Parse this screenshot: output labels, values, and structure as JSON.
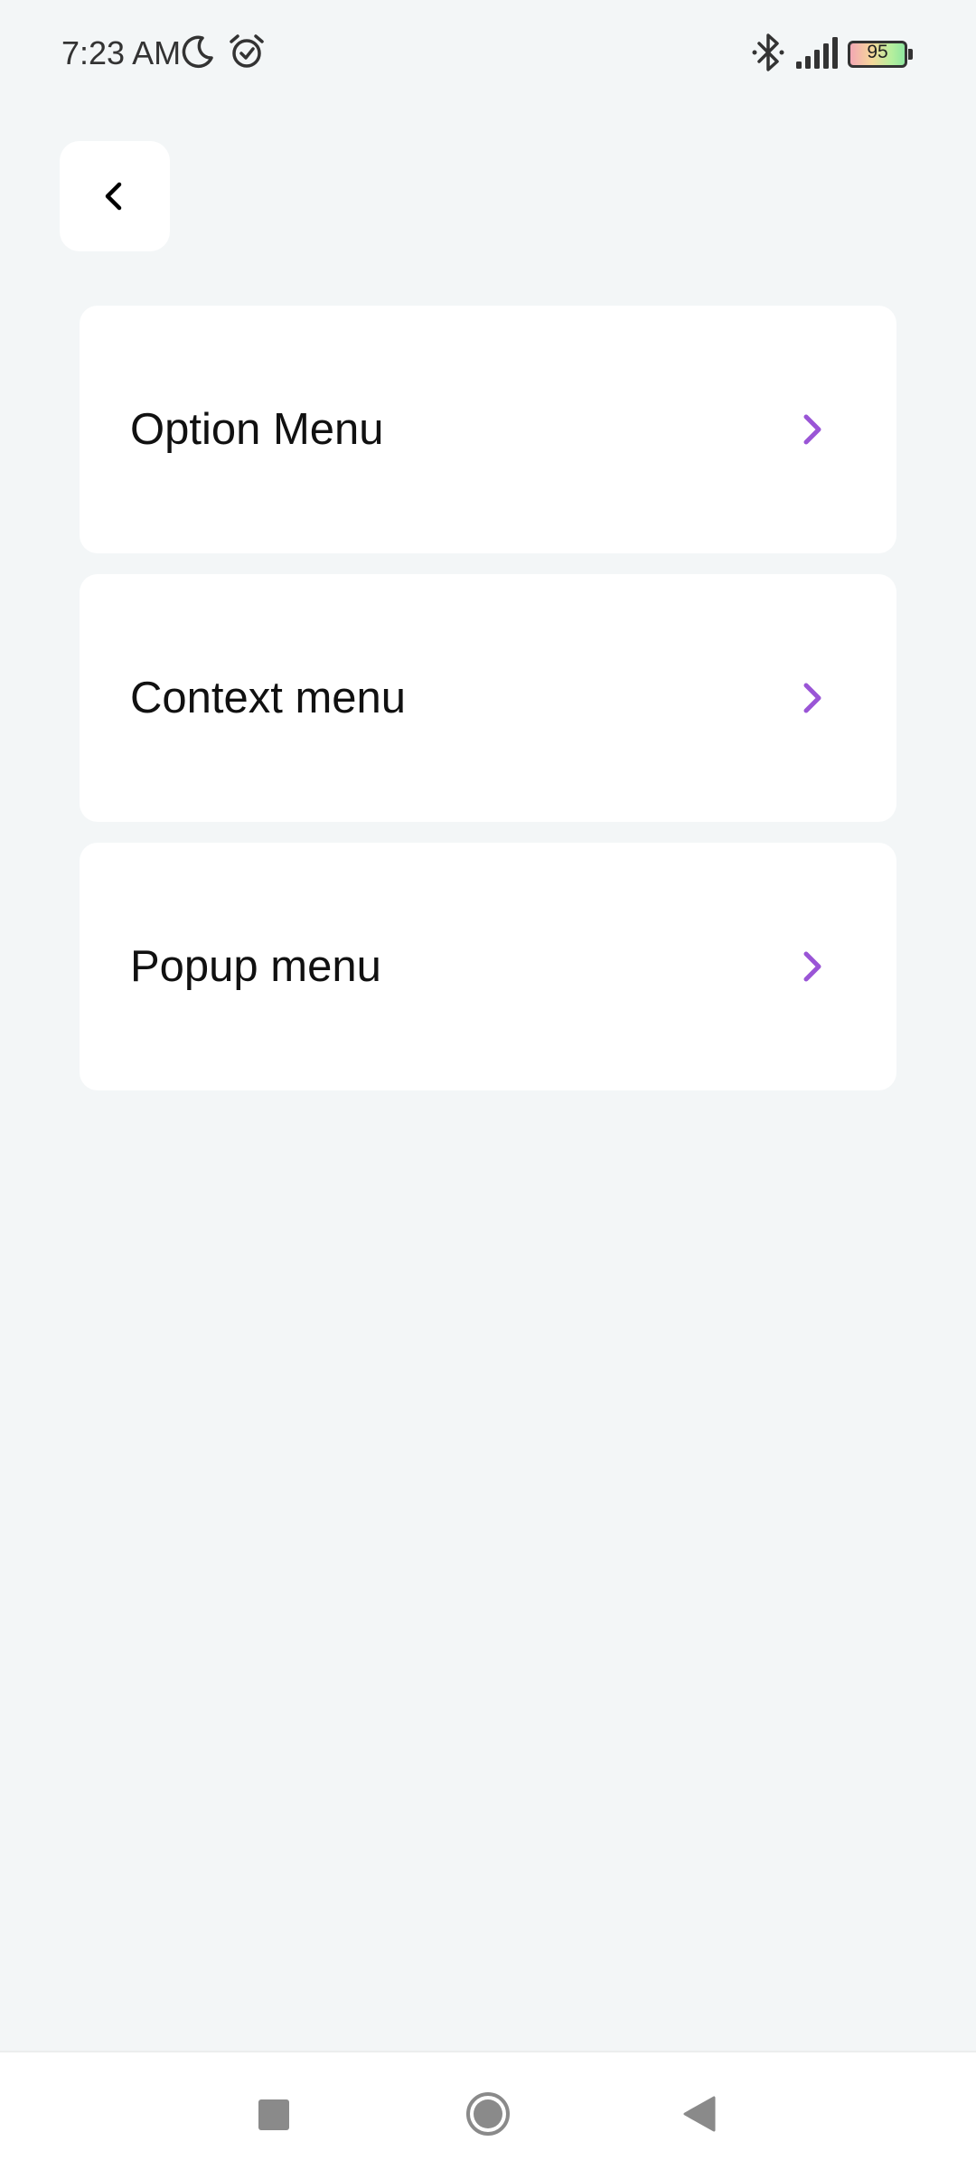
{
  "status_bar": {
    "time": "7:23 AM",
    "battery_level": "95",
    "icons": [
      "moon-icon",
      "alarm-icon",
      "bluetooth-icon",
      "signal-icon",
      "battery-icon"
    ]
  },
  "header": {
    "back_icon": "chevron-left-icon"
  },
  "menu_items": [
    {
      "label": "Option Menu",
      "icon": "chevron-right-icon"
    },
    {
      "label": "Context menu",
      "icon": "chevron-right-icon"
    },
    {
      "label": "Popup menu",
      "icon": "chevron-right-icon"
    }
  ],
  "nav_bar": {
    "buttons": [
      "recents-icon",
      "home-icon",
      "back-icon"
    ]
  },
  "colors": {
    "background": "#f3f6f7",
    "card": "#ffffff",
    "accent": "#9a55d6"
  }
}
